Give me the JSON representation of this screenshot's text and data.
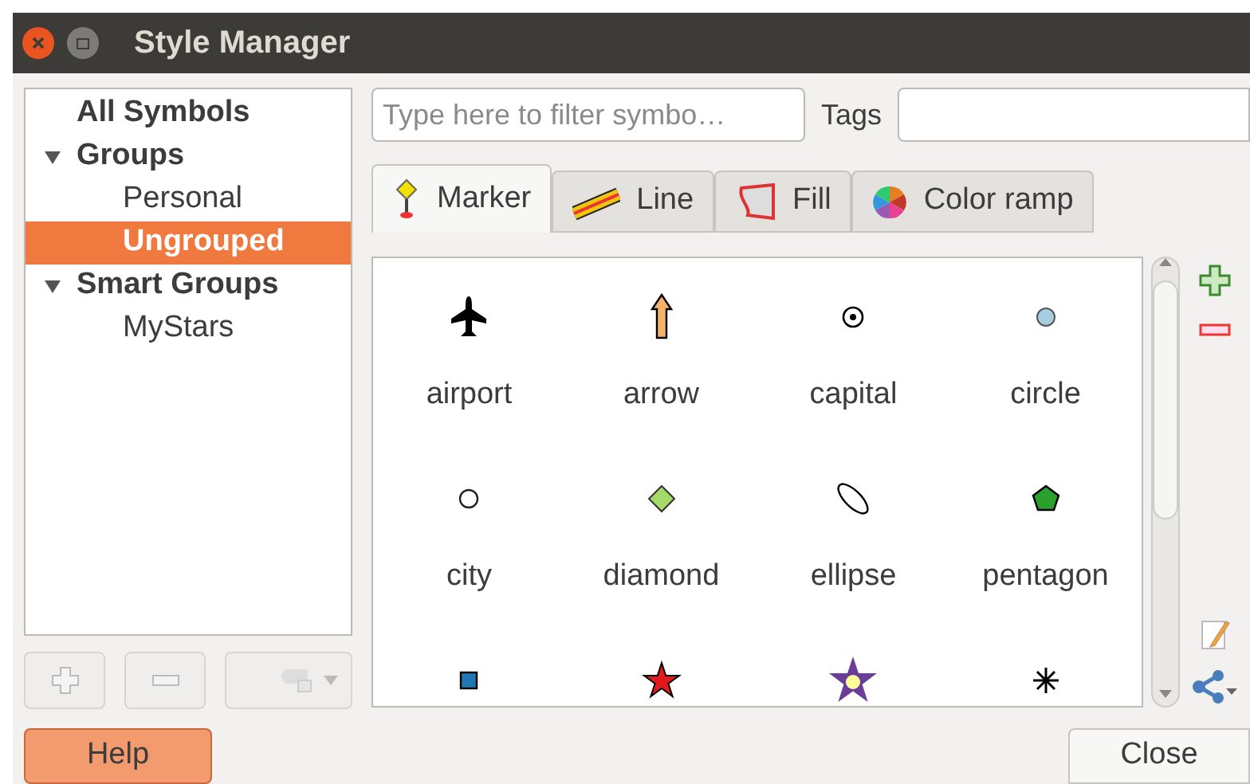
{
  "window": {
    "title": "Style Manager"
  },
  "tree": [
    {
      "label": "All Symbols",
      "bold": true,
      "selected": false
    },
    {
      "label": "Groups",
      "bold": true,
      "selected": false,
      "expanded": true,
      "children": [
        {
          "label": "Personal",
          "bold": false,
          "selected": false
        },
        {
          "label": "Ungrouped",
          "bold": true,
          "selected": true
        }
      ]
    },
    {
      "label": "Smart Groups",
      "bold": true,
      "selected": false,
      "expanded": true,
      "children": [
        {
          "label": "MyStars",
          "bold": false,
          "selected": false
        }
      ]
    }
  ],
  "filter": {
    "placeholder": "Type here to filter symbo…"
  },
  "tags": {
    "label": "Tags"
  },
  "tabs": [
    {
      "kind": "marker",
      "label": "Marker",
      "selected": true
    },
    {
      "kind": "line",
      "label": "Line",
      "selected": false
    },
    {
      "kind": "fill",
      "label": "Fill",
      "selected": false
    },
    {
      "kind": "ramp",
      "label": "Color ramp",
      "selected": false
    }
  ],
  "symbols": [
    {
      "kind": "airport",
      "label": "airport"
    },
    {
      "kind": "arrow",
      "label": "arrow"
    },
    {
      "kind": "capital",
      "label": "capital"
    },
    {
      "kind": "circle",
      "label": "circle"
    },
    {
      "kind": "city",
      "label": "city"
    },
    {
      "kind": "diamond",
      "label": "diamond"
    },
    {
      "kind": "ellipse",
      "label": "ellipse"
    },
    {
      "kind": "pentagon",
      "label": "pentagon"
    },
    {
      "kind": "square"
    },
    {
      "kind": "star"
    },
    {
      "kind": "bigstar"
    },
    {
      "kind": "asterisk"
    }
  ],
  "buttons": {
    "help": "Help",
    "close": "Close"
  }
}
